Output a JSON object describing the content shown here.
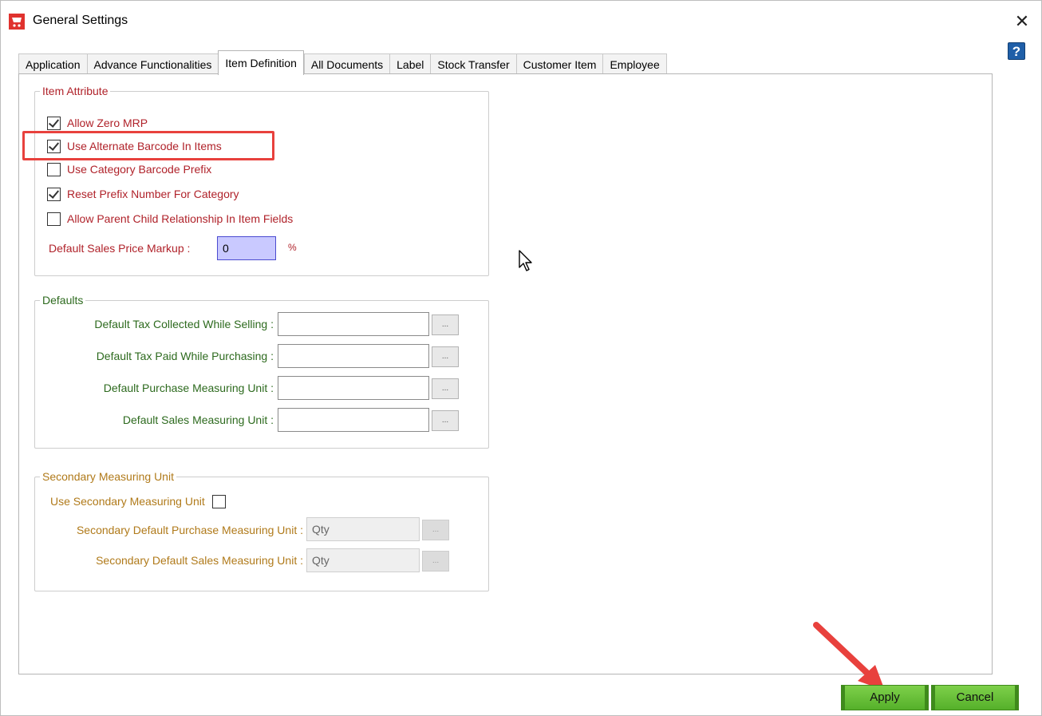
{
  "window": {
    "title": "General Settings",
    "close_glyph": "✕",
    "help_glyph": "?",
    "icon": "shopping-cart-icon"
  },
  "tabs": [
    {
      "label": "Application",
      "active": false
    },
    {
      "label": "Advance Functionalities",
      "active": false
    },
    {
      "label": "Item Definition",
      "active": true
    },
    {
      "label": "All Documents",
      "active": false
    },
    {
      "label": "Label",
      "active": false
    },
    {
      "label": "Stock Transfer",
      "active": false
    },
    {
      "label": "Customer Item",
      "active": false
    },
    {
      "label": "Employee",
      "active": false
    }
  ],
  "item_attribute": {
    "legend": "Item Attribute",
    "options": [
      {
        "label": "Allow Zero MRP",
        "checked": true
      },
      {
        "label": "Use Alternate Barcode In Items",
        "checked": true
      },
      {
        "label": "Use Category Barcode Prefix",
        "checked": false
      },
      {
        "label": "Reset Prefix Number For Category",
        "checked": true
      },
      {
        "label": "Allow Parent Child Relationship In Item Fields",
        "checked": false
      }
    ],
    "markup_label": "Default Sales Price Markup :",
    "markup_value": "0",
    "markup_unit": "%"
  },
  "defaults": {
    "legend": "Defaults",
    "fields": [
      {
        "label": "Default Tax Collected  While Selling :",
        "value": "",
        "browse": "..."
      },
      {
        "label": "Default Tax Paid While Purchasing :",
        "value": "",
        "browse": "..."
      },
      {
        "label": "Default Purchase Measuring Unit :",
        "value": "",
        "browse": "..."
      },
      {
        "label": "Default Sales Measuring Unit :",
        "value": "",
        "browse": "..."
      }
    ]
  },
  "secondary": {
    "legend": "Secondary Measuring Unit",
    "use_label": "Use Secondary Measuring Unit",
    "use_checked": false,
    "purchase_label": "Secondary Default Purchase Measuring Unit :",
    "purchase_value": "Qty",
    "sales_label": "Secondary Default Sales Measuring Unit :",
    "sales_value": "Qty",
    "browse": "..."
  },
  "buttons": {
    "apply": "Apply",
    "cancel": "Cancel"
  },
  "colors": {
    "label_red": "#b0222a",
    "label_green": "#2d6a1e",
    "label_orange": "#b07a1a",
    "highlight": "#e8413d",
    "button_green": "#6cc23a"
  }
}
